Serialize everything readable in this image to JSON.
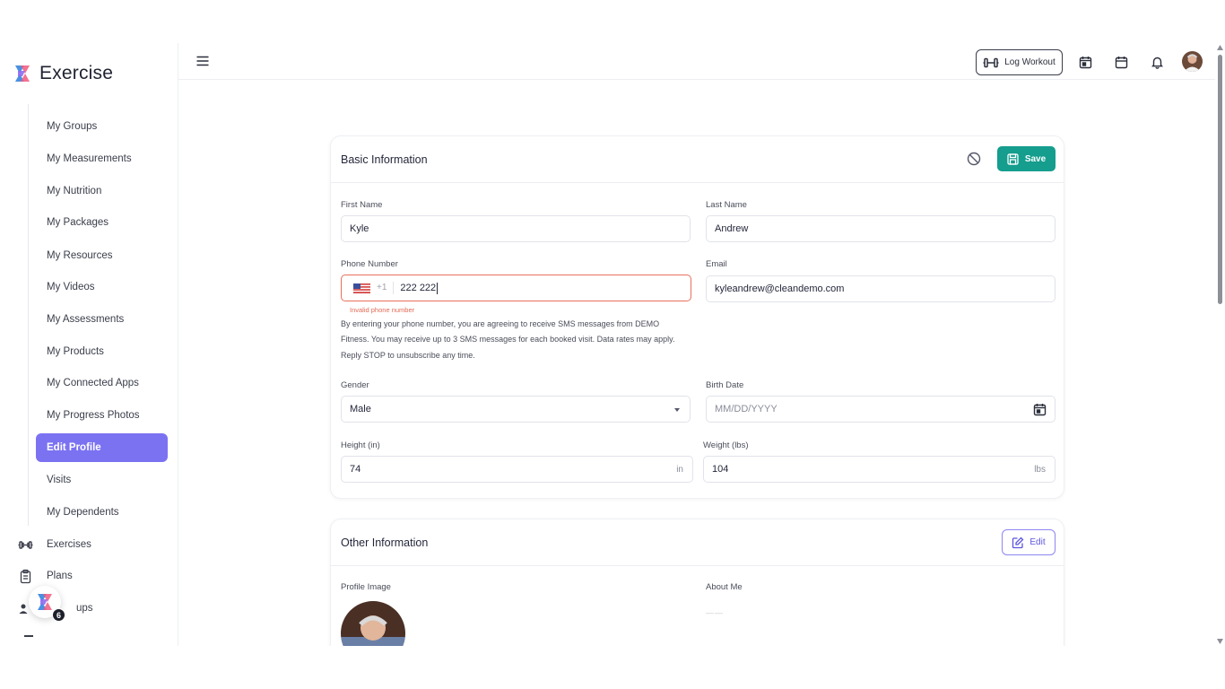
{
  "app": {
    "name": "Exercise"
  },
  "sidebar": {
    "sub_items": [
      {
        "label": "My Groups"
      },
      {
        "label": "My Measurements"
      },
      {
        "label": "My Nutrition"
      },
      {
        "label": "My Packages"
      },
      {
        "label": "My Resources"
      },
      {
        "label": "My Videos"
      },
      {
        "label": "My Assessments"
      },
      {
        "label": "My Products"
      },
      {
        "label": "My Connected Apps"
      },
      {
        "label": "My Progress Photos"
      },
      {
        "label": "Edit Profile",
        "active": true
      },
      {
        "label": "Visits"
      },
      {
        "label": "My Dependents"
      }
    ],
    "main_items": [
      {
        "label": "Exercises",
        "icon": "dumbbell-icon"
      },
      {
        "label": "Plans",
        "icon": "clipboard-icon"
      },
      {
        "label": "ups",
        "icon": "users-icon"
      }
    ],
    "fab_badge": "6"
  },
  "topbar": {
    "log_workout_label": "Log Workout"
  },
  "basic_info": {
    "title": "Basic Information",
    "save_label": "Save",
    "first_name": {
      "label": "First Name",
      "value": "Kyle"
    },
    "last_name": {
      "label": "Last Name",
      "value": "Andrew"
    },
    "phone": {
      "label": "Phone Number",
      "dial_code": "+1",
      "value": "222 222",
      "error": "Invalid phone number"
    },
    "email": {
      "label": "Email",
      "value": "kyleandrew@cleandemo.com"
    },
    "sms_note": [
      "By entering your phone number, you are agreeing to receive SMS messages from DEMO",
      "Fitness. You may receive up to 3 SMS messages for each booked visit. Data rates may apply.",
      "Reply STOP to unsubscribe any time."
    ],
    "gender": {
      "label": "Gender",
      "value": "Male"
    },
    "birth_date": {
      "label": "Birth Date",
      "placeholder": "MM/DD/YYYY"
    },
    "height": {
      "label": "Height (in)",
      "value": "74",
      "unit": "in"
    },
    "weight": {
      "label": "Weight (lbs)",
      "value": "104",
      "unit": "lbs"
    }
  },
  "other_info": {
    "title": "Other Information",
    "edit_label": "Edit",
    "profile_image_label": "Profile Image",
    "about_me_label": "About Me",
    "about_me_value": "——"
  },
  "colors": {
    "accent": "#7b72f2",
    "save": "#159d8e",
    "error": "#e8705c"
  }
}
